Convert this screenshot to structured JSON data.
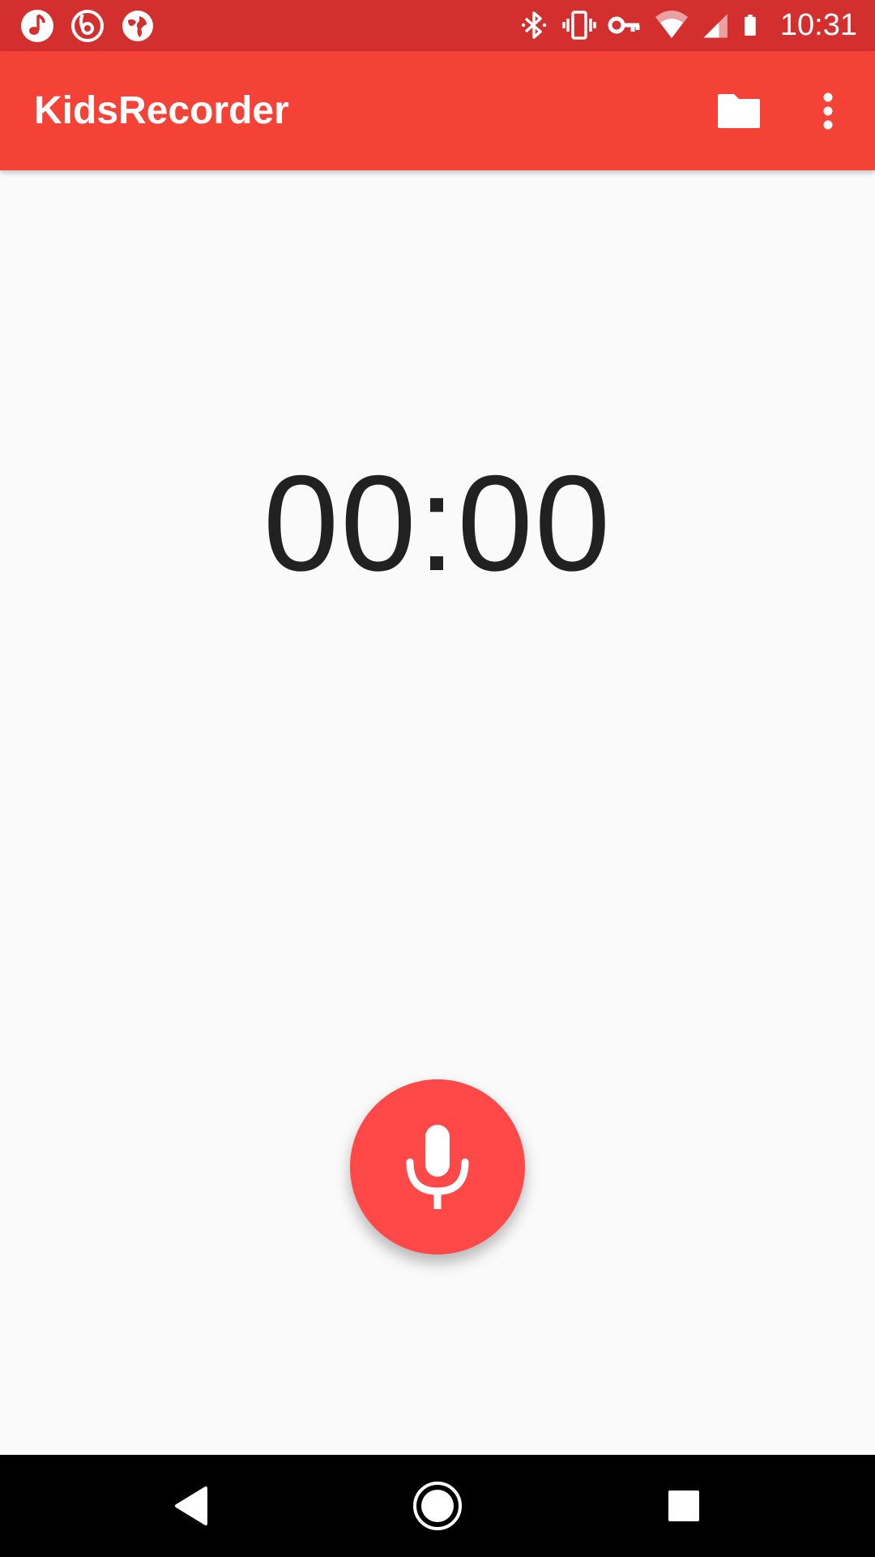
{
  "status_bar": {
    "time": "10:31",
    "left_icons": [
      "music-notification-icon",
      "swirl-notification-icon",
      "globe-notification-icon"
    ],
    "right_icons": [
      "bluetooth-icon",
      "vibrate-icon",
      "vpn-key-icon",
      "wifi-icon",
      "cell-signal-icon",
      "battery-icon"
    ],
    "background_color": "#d32f2f"
  },
  "app_bar": {
    "title": "KidsRecorder",
    "actions": [
      "folder-icon",
      "more-vert-icon"
    ],
    "background_color": "#f44336"
  },
  "main": {
    "timer": "00:00"
  },
  "record_button": {
    "icon": "microphone-icon",
    "color": "#ff4848"
  },
  "nav_bar": {
    "buttons": [
      "back-icon",
      "home-icon",
      "recents-icon"
    ]
  }
}
